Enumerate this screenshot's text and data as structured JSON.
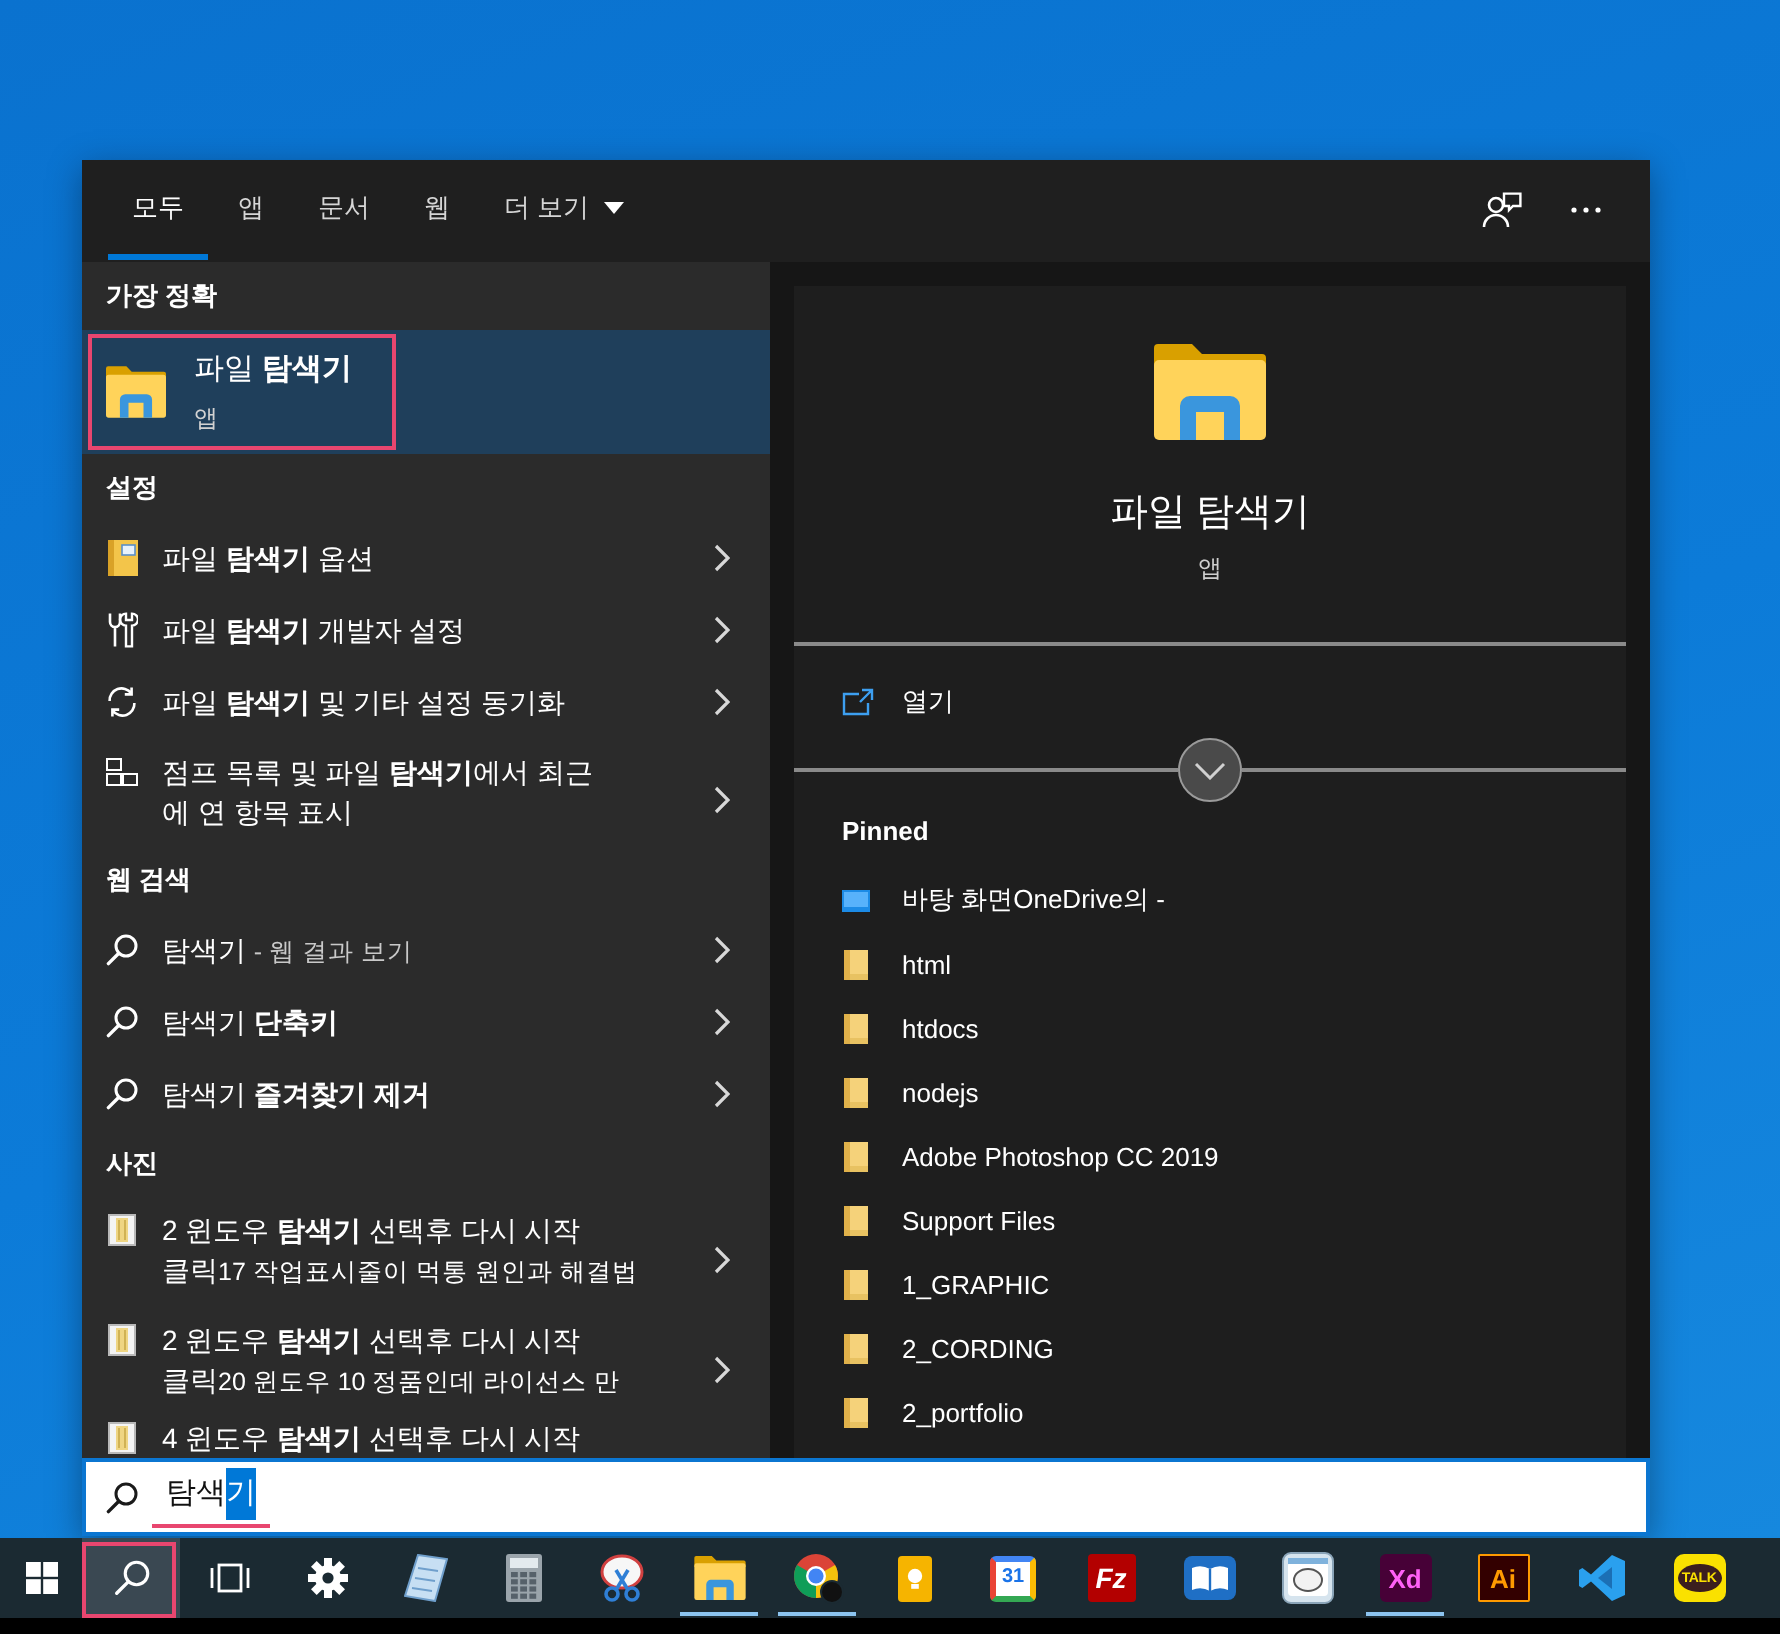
{
  "tabs": [
    {
      "label": "모두",
      "selected": true,
      "dropdown": false
    },
    {
      "label": "앱",
      "selected": false,
      "dropdown": false
    },
    {
      "label": "문서",
      "selected": false,
      "dropdown": false
    },
    {
      "label": "웹",
      "selected": false,
      "dropdown": false
    },
    {
      "label": "더 보기",
      "selected": false,
      "dropdown": true
    }
  ],
  "best_match": {
    "heading": "가장 정확",
    "title": "파일 **탐색기**",
    "subtitle": "앱",
    "selected": true,
    "highlighted": true
  },
  "settings": {
    "heading": "설정",
    "items": [
      {
        "kind": "folder-options",
        "text": "파일 **탐색기** 옵션"
      },
      {
        "kind": "tools",
        "text": "파일 **탐색기** 개발자 설정"
      },
      {
        "kind": "sync",
        "text": "파일 **탐색기** 및 기타 설정 동기화"
      },
      {
        "kind": "jump-list",
        "text": "점프 목록 및 파일 **탐색기**에서 최근\n에 연 항목 표시"
      }
    ]
  },
  "web_search": {
    "heading": "웹 검색",
    "items": [
      {
        "text": "탐색기",
        "suffix": "- 웹 결과 보기"
      },
      {
        "text": "탐색기 **단축키**"
      },
      {
        "text": "탐색기 **즐겨찾기 제거**"
      }
    ]
  },
  "photos": {
    "heading": "사진",
    "items": [
      {
        "title": "2 윈도우 **탐색기** 선택후 다시 시작",
        "continuation": "클릭",
        "detail": "17 작업표시줄이 먹통 원인과 해결법"
      },
      {
        "title": "2 윈도우 **탐색기** 선택후 다시 시작",
        "continuation": "클릭",
        "detail": "20 윈도우 10 정품인데 라이선스 만"
      },
      {
        "title": "4 윈도우 **탐색기** 선택후 다시 시작"
      }
    ]
  },
  "preview": {
    "title": "파일 탐색기",
    "subtitle": "앱",
    "action": "열기",
    "pinned_heading": "Pinned",
    "pinned": [
      {
        "kind": "desktop",
        "label": "바탕 화면OneDrive의 -"
      },
      {
        "kind": "folder",
        "label": "html"
      },
      {
        "kind": "folder",
        "label": "htdocs"
      },
      {
        "kind": "folder",
        "label": "nodejs"
      },
      {
        "kind": "folder",
        "label": "Adobe Photoshop CC 2019"
      },
      {
        "kind": "folder",
        "label": "Support Files"
      },
      {
        "kind": "folder",
        "label": "1_GRAPHIC"
      },
      {
        "kind": "folder",
        "label": "2_CORDING"
      },
      {
        "kind": "folder",
        "label": "2_portfolio"
      }
    ]
  },
  "search": {
    "value": "탐색",
    "selected_text": "기",
    "underlined": true
  },
  "taskbar": [
    {
      "kind": "start",
      "active": false,
      "running": false,
      "highlighted": false
    },
    {
      "kind": "search",
      "active": true,
      "running": false,
      "highlighted": true
    },
    {
      "kind": "task-view",
      "active": false,
      "running": false,
      "highlighted": false
    },
    {
      "kind": "settings",
      "active": false,
      "running": false,
      "highlighted": false
    },
    {
      "kind": "notepad",
      "active": false,
      "running": false,
      "highlighted": false
    },
    {
      "kind": "calculator",
      "active": false,
      "running": false,
      "highlighted": false
    },
    {
      "kind": "snipping",
      "active": false,
      "running": false,
      "highlighted": false
    },
    {
      "kind": "explorer",
      "active": false,
      "running": true,
      "highlighted": false
    },
    {
      "kind": "browser",
      "active": false,
      "running": true,
      "highlighted": false
    },
    {
      "kind": "keep",
      "active": false,
      "running": false,
      "highlighted": false
    },
    {
      "kind": "calendar",
      "label": "31",
      "active": false,
      "running": false,
      "highlighted": false
    },
    {
      "kind": "filezilla",
      "label": "Fz",
      "active": false,
      "running": false,
      "highlighted": false
    },
    {
      "kind": "reader",
      "active": false,
      "running": false,
      "highlighted": false
    },
    {
      "kind": "mascot-app",
      "active": false,
      "running": false,
      "highlighted": false
    },
    {
      "kind": "xd",
      "label": "Xd",
      "active": false,
      "running": true,
      "highlighted": false
    },
    {
      "kind": "illustrator",
      "label": "Ai",
      "active": false,
      "running": false,
      "highlighted": false
    },
    {
      "kind": "code-editor",
      "active": false,
      "running": false,
      "highlighted": false
    },
    {
      "kind": "talk",
      "label": "TALK",
      "active": false,
      "running": false,
      "highlighted": false
    }
  ]
}
